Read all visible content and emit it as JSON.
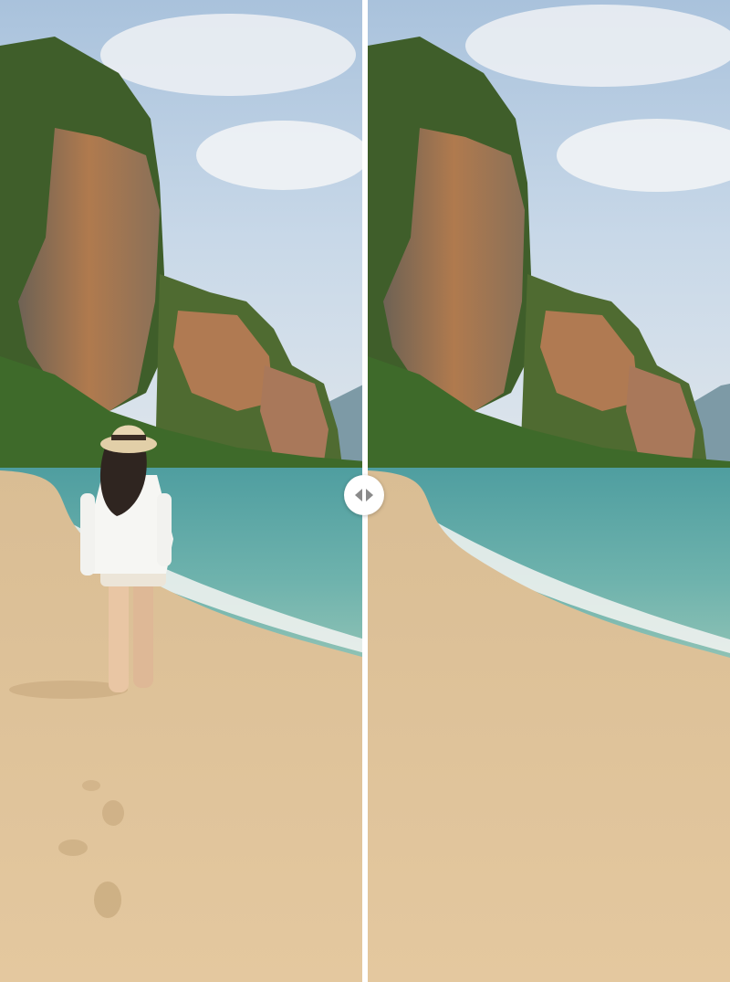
{
  "comparison": {
    "before_label": "",
    "after_label": "",
    "split_position_percent": 50
  },
  "before_image": {
    "subject": "person-walking-on-beach",
    "alt": ""
  },
  "after_image": {
    "subject": "empty-beach",
    "alt": ""
  },
  "handle": {
    "icon": "split-handle-arrows-icon"
  },
  "colors": {
    "divider": "#ffffff",
    "handle_bg": "#ffffff",
    "handle_arrows": "#8a8a8a"
  }
}
